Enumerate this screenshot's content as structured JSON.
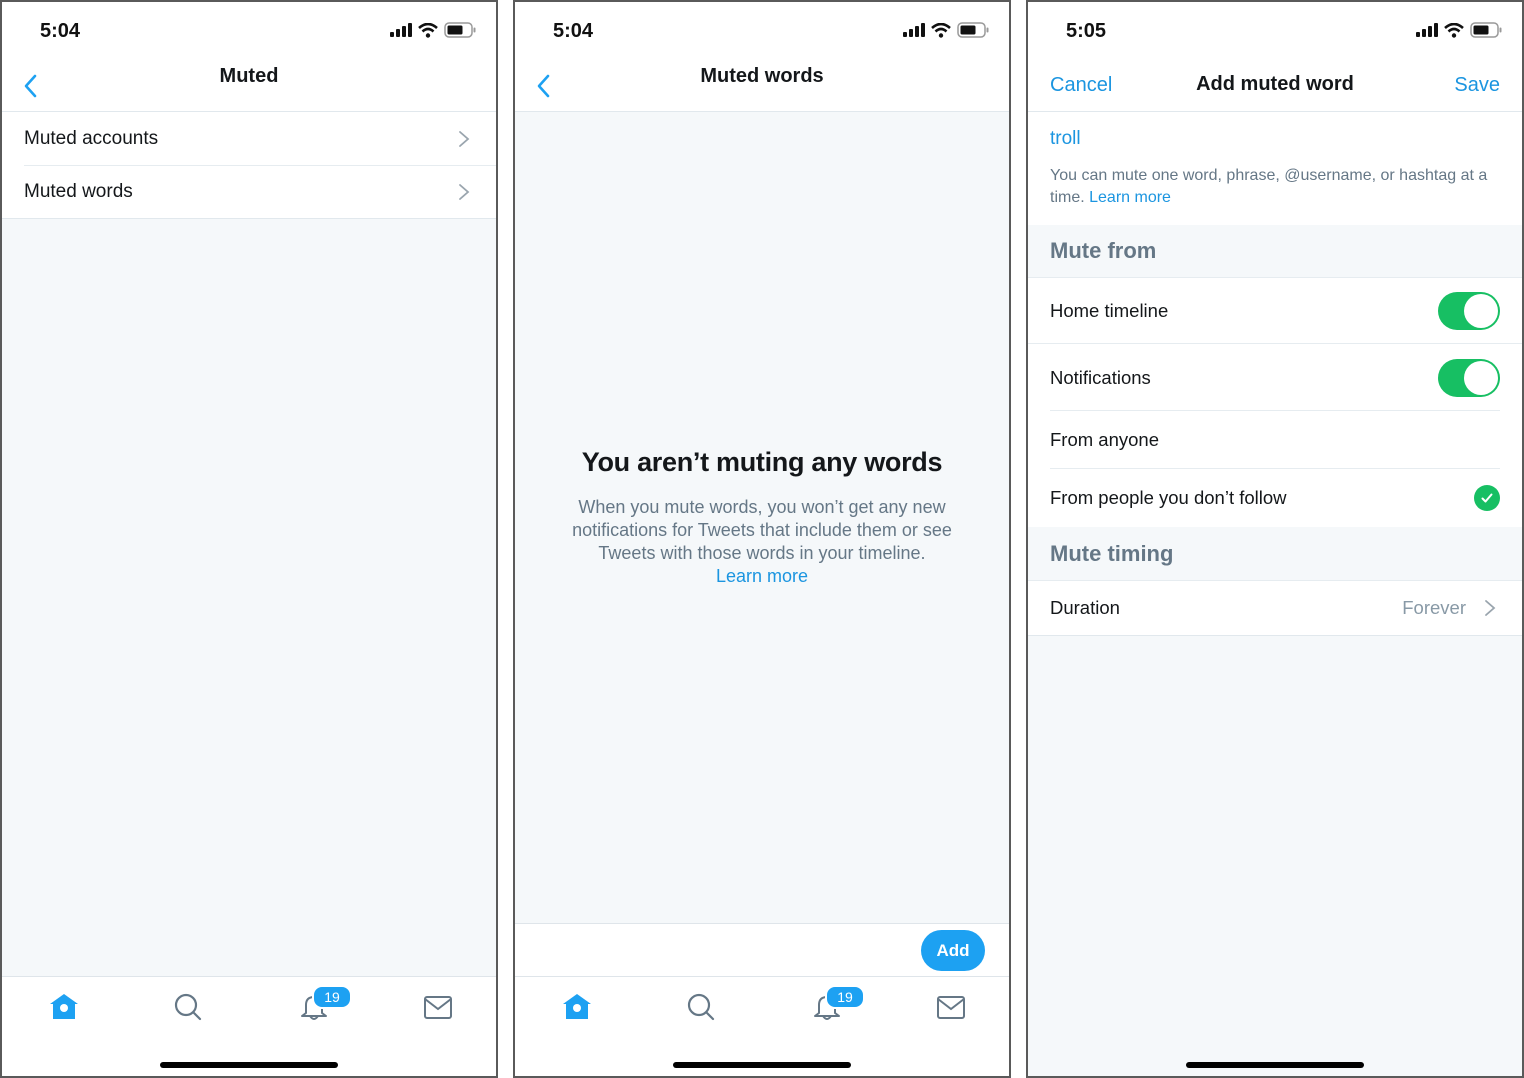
{
  "colors": {
    "accent": "#1da1f2",
    "link": "#1b95e0",
    "toggle_on": "#17bf63",
    "background": "#f5f8fa",
    "secondary_text": "#657786"
  },
  "screens": [
    {
      "status": {
        "time": "5:04"
      },
      "nav": {
        "title": "Muted",
        "back_icon": "chevron-left-icon"
      },
      "items": [
        {
          "label": "Muted accounts"
        },
        {
          "label": "Muted words"
        }
      ],
      "tabbar": {
        "notifications_badge": "19"
      }
    },
    {
      "status": {
        "time": "5:04"
      },
      "nav": {
        "title": "Muted words",
        "back_icon": "chevron-left-icon"
      },
      "empty_state": {
        "title": "You aren’t muting any words",
        "text": "When you mute words, you won’t get any new notifications for Tweets that include them or see Tweets with those words in your timeline.",
        "link": "Learn more"
      },
      "add_label": "Add",
      "tabbar": {
        "notifications_badge": "19"
      }
    },
    {
      "status": {
        "time": "5:05"
      },
      "nav": {
        "title": "Add muted word",
        "cancel": "Cancel",
        "save": "Save"
      },
      "word_value": "troll",
      "help_text": "You can mute one word, phrase, @username, or hashtag at a time.",
      "help_link": "Learn more",
      "mute_from": {
        "header": "Mute from",
        "home_timeline": {
          "label": "Home timeline",
          "on": true
        },
        "notifications": {
          "label": "Notifications",
          "on": true
        },
        "from_anyone": {
          "label": "From anyone",
          "selected": false
        },
        "from_not_following": {
          "label": "From people you don’t follow",
          "selected": true
        }
      },
      "mute_timing": {
        "header": "Mute timing",
        "duration_label": "Duration",
        "duration_value": "Forever"
      }
    }
  ]
}
